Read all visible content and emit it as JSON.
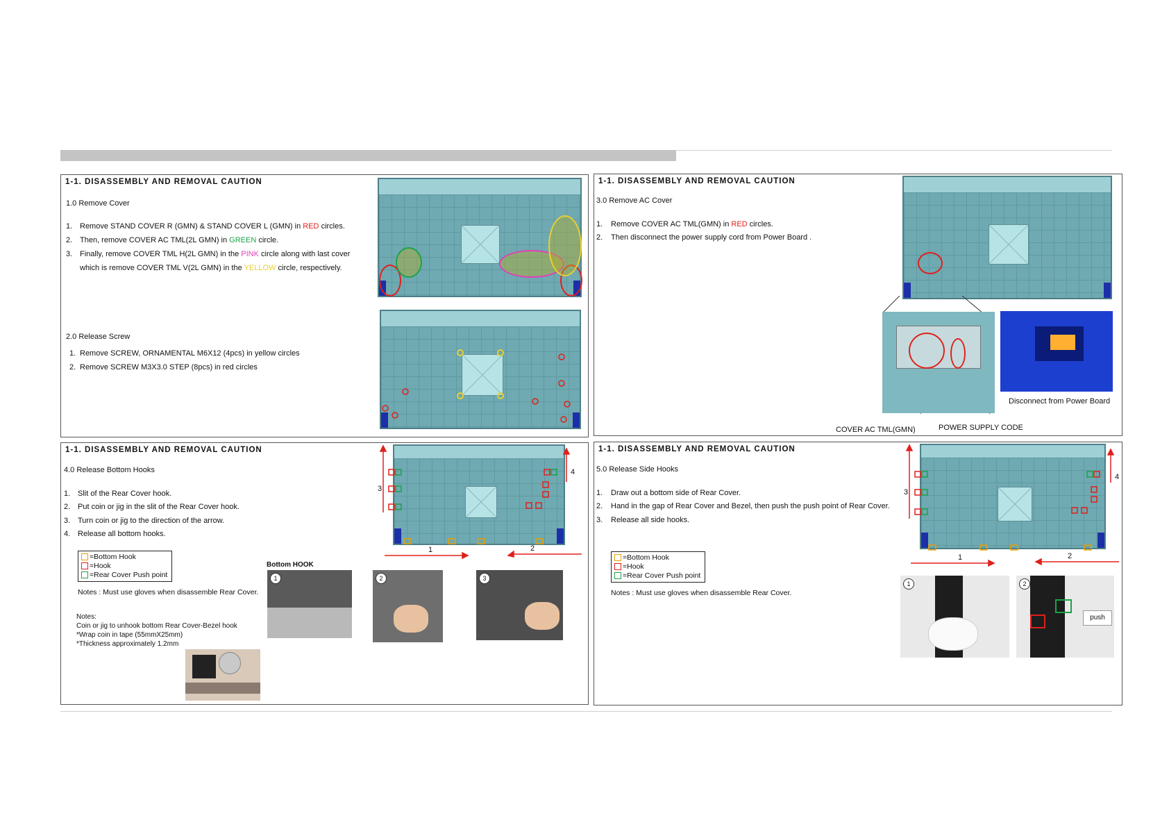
{
  "title": "1-1. DISASSEMBLY AND REMOVAL CAUTION",
  "p1": {
    "step1_heading": "1.0  Remove Cover",
    "s1_n1": "1.",
    "s1_a": "Remove STAND COVER R (GMN) & STAND COVER L (GMN) in ",
    "s1_a_red": "RED",
    "s1_a_end": " circles.",
    "s1_n2": "2.",
    "s1_b": "Then, remove COVER AC TML(2L GMN) in ",
    "s1_b_green": "GREEN",
    "s1_b_end": " circle.",
    "s1_n3": "3.",
    "s1_c": "Finally, remove COVER TML H(2L GMN) in the ",
    "s1_c_pink": "PINK",
    "s1_c_end": " circle along with last cover",
    "s1_d": "which is remove COVER TML V(2L GMN) in the ",
    "s1_d_yellow": "YELLOW",
    "s1_d_end": " circle, respectively.",
    "step2_heading": "2.0  Release Screw",
    "s2_n1": "1.",
    "s2_a": "Remove SCREW, ORNAMENTAL M6X12 (4pcs) in yellow circles",
    "s2_n2": "2.",
    "s2_b": "Remove SCREW M3X3.0 STEP (8pcs) in red circles"
  },
  "p2": {
    "heading": "3.0  Remove AC Cover",
    "n1": "1.",
    "a": "Remove COVER AC TML(GMN) in ",
    "a_red": "RED",
    "a_end": " circles.",
    "n2": "2.",
    "b": "Then disconnect the power supply cord from Power Board .",
    "cap_cover": "COVER AC TML(GMN)",
    "cap_power": "POWER SUPPLY CODE",
    "cap_disconnect": "Disconnect from Power Board"
  },
  "p3": {
    "heading": "4.0  Release Bottom Hooks",
    "n1": "1.",
    "a": "Slit of the Rear Cover hook.",
    "n2": "2.",
    "b": "Put coin or jig in the slit of the Rear Cover hook.",
    "n3": "3.",
    "c": "Turn coin or jig to the direction of the arrow.",
    "n4": "4.",
    "d": "Release all bottom hooks.",
    "legend_bottom": "=Bottom Hook",
    "legend_hook": "=Hook",
    "legend_push": "=Rear Cover Push point",
    "notes": "Notes : Must use gloves when disassemble Rear Cover.",
    "notes2_title": "Notes:",
    "notes2_a": "Coin or jig to unhook bottom Rear Cover-Bezel hook",
    "notes2_b": "*Wrap coin in tape (55mmX25mm)",
    "notes2_c": "*Thickness approximately 1.2mm",
    "bottom_hook_label": "Bottom HOOK",
    "side_3": "3",
    "side_4": "4",
    "dir_1": "1",
    "dir_2": "2",
    "photo_1": "1",
    "photo_2": "2",
    "photo_3": "3"
  },
  "p4": {
    "heading": "5.0  Release Side Hooks",
    "n1": "1.",
    "a": "Draw out a bottom side of Rear Cover.",
    "n2": "2.",
    "b": "Hand in the gap of Rear Cover and Bezel, then push the push point of Rear Cover.",
    "n3": "3.",
    "c": "Release all side hooks.",
    "legend_bottom": "=Bottom Hook",
    "legend_hook": "=Hook",
    "legend_push": "=Rear Cover Push point",
    "notes": "Notes : Must use gloves when disassemble Rear Cover.",
    "side_3": "3",
    "side_4": "4",
    "dir_1": "1",
    "dir_2": "2",
    "photo_1": "1",
    "photo_2": "2",
    "push_label": "push"
  },
  "colors": {
    "red": "#e0201c",
    "green": "#1aa34a",
    "pink": "#e23fb8",
    "yellow": "#e8d030",
    "hook_orange": "#e8a000",
    "push_green": "#1aa34a"
  }
}
